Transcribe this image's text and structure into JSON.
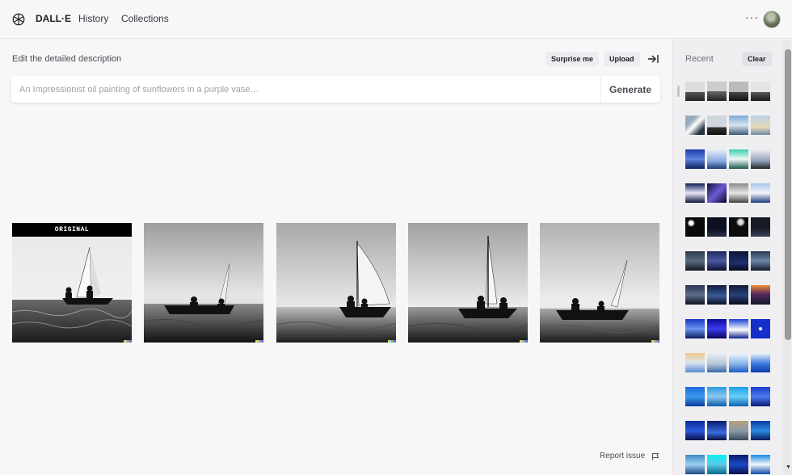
{
  "header": {
    "brand": "DALL·E",
    "nav": [
      "History",
      "Collections"
    ],
    "more": "···"
  },
  "editor": {
    "label": "Edit the detailed description",
    "surprise": "Surprise me",
    "upload": "Upload",
    "placeholder": "An Impressionist oil painting of sunflowers in a purple vase…",
    "generate": "Generate"
  },
  "images": {
    "original_label": "ORIGINAL",
    "count": 5
  },
  "footer": {
    "report": "Report issue"
  },
  "sidebar": {
    "recent": "Recent",
    "clear": "Clear"
  },
  "colors": {
    "signature": [
      "#f5d547",
      "#7bd3e0",
      "#5ec27a",
      "#e0657a",
      "#4a6ee0"
    ]
  }
}
